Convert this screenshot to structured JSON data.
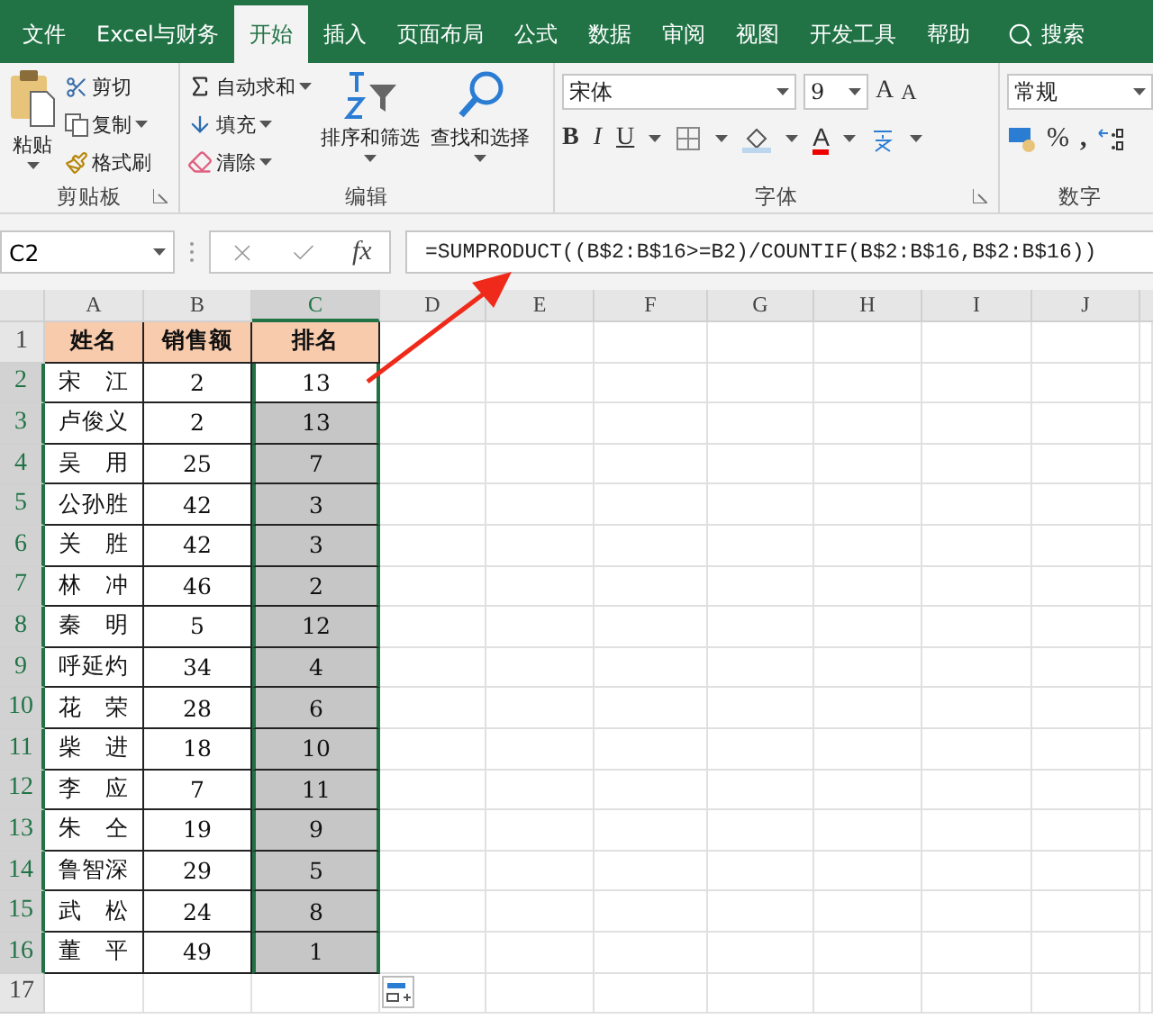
{
  "menu_tabs": [
    {
      "label": "文件",
      "selected": false
    },
    {
      "label": "Excel与财务",
      "selected": false
    },
    {
      "label": "开始",
      "selected": true
    },
    {
      "label": "插入",
      "selected": false
    },
    {
      "label": "页面布局",
      "selected": false
    },
    {
      "label": "公式",
      "selected": false
    },
    {
      "label": "数据",
      "selected": false
    },
    {
      "label": "审阅",
      "selected": false
    },
    {
      "label": "视图",
      "selected": false
    },
    {
      "label": "开发工具",
      "selected": false
    },
    {
      "label": "帮助",
      "selected": false
    }
  ],
  "search": {
    "label": "搜索"
  },
  "clipboard": {
    "title": "剪贴板",
    "paste": "粘贴",
    "cut": "剪切",
    "copy": "复制",
    "format_painter": "格式刷"
  },
  "editing": {
    "title": "编辑",
    "autosum": "自动求和",
    "fill": "填充",
    "clear": "清除",
    "sort_filter": "排序和筛选",
    "find_select": "查找和选择"
  },
  "font": {
    "title": "字体",
    "font_name": "宋体",
    "font_size": "9",
    "grow_label": "A",
    "shrink_label": "A",
    "bold": "B",
    "italic": "I",
    "underline": "U",
    "font_color_label": "A"
  },
  "number": {
    "title": "数字",
    "format": "常规",
    "percent": "%",
    "comma": ","
  },
  "formula_bar": {
    "name_box": "C2",
    "fx": "fx",
    "formula": "=SUMPRODUCT((B$2:B$16>=B2)/COUNTIF(B$2:B$16,B$2:B$16))"
  },
  "columns": [
    {
      "label": "A",
      "selected": false
    },
    {
      "label": "B",
      "selected": false
    },
    {
      "label": "C",
      "selected": true
    },
    {
      "label": "D",
      "selected": false
    },
    {
      "label": "E",
      "selected": false
    },
    {
      "label": "F",
      "selected": false
    },
    {
      "label": "G",
      "selected": false
    },
    {
      "label": "H",
      "selected": false
    },
    {
      "label": "I",
      "selected": false
    },
    {
      "label": "J",
      "selected": false
    }
  ],
  "rows": [
    {
      "number": "1",
      "kind": "header",
      "cells": [
        "姓名",
        "销售额",
        "排名"
      ],
      "selected": false,
      "active": false
    },
    {
      "number": "2",
      "kind": "data",
      "cells": [
        "宋　江",
        "2",
        "13"
      ],
      "selected": true,
      "active": true
    },
    {
      "number": "3",
      "kind": "data",
      "cells": [
        "卢俊义",
        "2",
        "13"
      ],
      "selected": true,
      "active": false
    },
    {
      "number": "4",
      "kind": "data",
      "cells": [
        "吴　用",
        "25",
        "7"
      ],
      "selected": true,
      "active": false
    },
    {
      "number": "5",
      "kind": "data",
      "cells": [
        "公孙胜",
        "42",
        "3"
      ],
      "selected": true,
      "active": false
    },
    {
      "number": "6",
      "kind": "data",
      "cells": [
        "关　胜",
        "42",
        "3"
      ],
      "selected": true,
      "active": false
    },
    {
      "number": "7",
      "kind": "data",
      "cells": [
        "林　冲",
        "46",
        "2"
      ],
      "selected": true,
      "active": false
    },
    {
      "number": "8",
      "kind": "data",
      "cells": [
        "秦　明",
        "5",
        "12"
      ],
      "selected": true,
      "active": false
    },
    {
      "number": "9",
      "kind": "data",
      "cells": [
        "呼延灼",
        "34",
        "4"
      ],
      "selected": true,
      "active": false
    },
    {
      "number": "10",
      "kind": "data",
      "cells": [
        "花　荣",
        "28",
        "6"
      ],
      "selected": true,
      "active": false
    },
    {
      "number": "11",
      "kind": "data",
      "cells": [
        "柴　进",
        "18",
        "10"
      ],
      "selected": true,
      "active": false
    },
    {
      "number": "12",
      "kind": "data",
      "cells": [
        "李　应",
        "7",
        "11"
      ],
      "selected": true,
      "active": false
    },
    {
      "number": "13",
      "kind": "data",
      "cells": [
        "朱　仝",
        "19",
        "9"
      ],
      "selected": true,
      "active": false
    },
    {
      "number": "14",
      "kind": "data",
      "cells": [
        "鲁智深",
        "29",
        "5"
      ],
      "selected": true,
      "active": false
    },
    {
      "number": "15",
      "kind": "data",
      "cells": [
        "武　松",
        "24",
        "8"
      ],
      "selected": true,
      "active": false
    },
    {
      "number": "16",
      "kind": "data",
      "cells": [
        "董　平",
        "49",
        "1"
      ],
      "selected": true,
      "active": false
    },
    {
      "number": "17",
      "kind": "empty",
      "selected": false,
      "active": false
    }
  ]
}
